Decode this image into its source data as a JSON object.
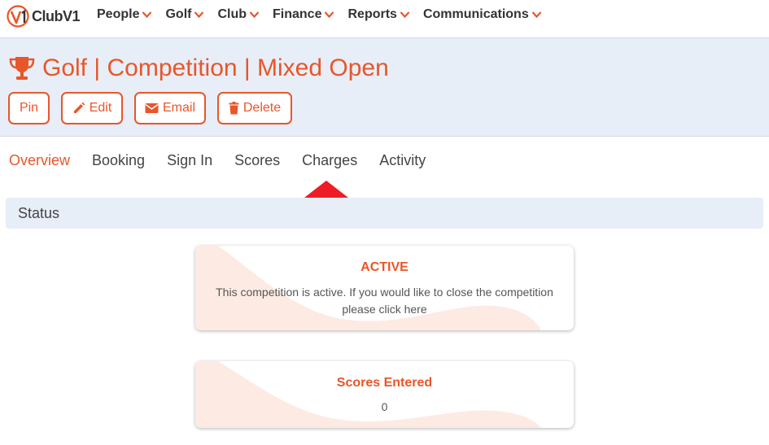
{
  "brand": {
    "name": "ClubV1"
  },
  "nav": {
    "items": [
      {
        "label": "People"
      },
      {
        "label": "Golf"
      },
      {
        "label": "Club"
      },
      {
        "label": "Finance"
      },
      {
        "label": "Reports"
      },
      {
        "label": "Communications"
      }
    ]
  },
  "header": {
    "title": "Golf | Competition | Mixed Open",
    "actions": {
      "pin": "Pin",
      "edit": "Edit",
      "email": "Email",
      "delete": "Delete"
    }
  },
  "tabs": [
    {
      "label": "Overview",
      "active": true
    },
    {
      "label": "Booking"
    },
    {
      "label": "Sign In"
    },
    {
      "label": "Scores"
    },
    {
      "label": "Charges"
    },
    {
      "label": "Activity"
    }
  ],
  "status": {
    "heading": "Status",
    "active_card": {
      "title": "ACTIVE",
      "line1": "This competition is active. If you would like to close the competition",
      "line2": "please click here"
    },
    "scores_card": {
      "title": "Scores Entered",
      "value": "0"
    }
  },
  "colors": {
    "accent": "#e8562a",
    "header_bg": "#e8eef8",
    "arrow": "#ee1c24"
  }
}
